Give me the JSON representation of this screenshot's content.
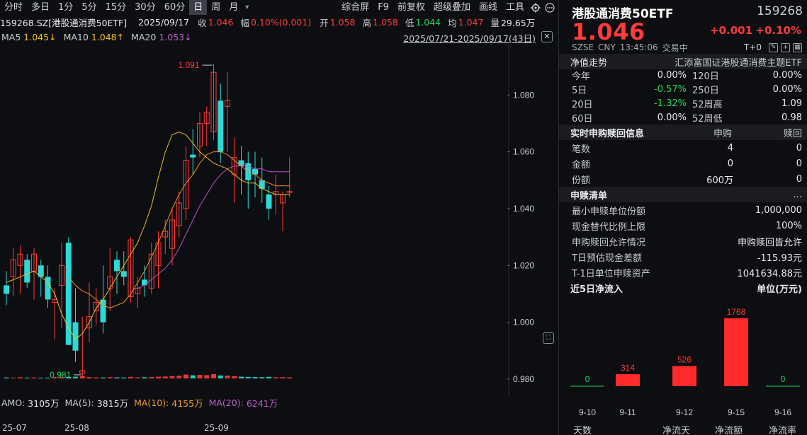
{
  "toolbar": {
    "periods": [
      "分时",
      "多日",
      "1分",
      "5分",
      "15分",
      "30分",
      "60分",
      "日",
      "周",
      "月"
    ],
    "active": "日",
    "right_items": [
      "综合屏",
      "F9",
      "前复权",
      "超级叠加",
      "画线",
      "工具"
    ]
  },
  "infoline": {
    "code": "159268.SZ[港股通消费50ETF]",
    "date": "2025/09/17",
    "close_label": "收",
    "close": "1.046",
    "amp_label": "幅",
    "amp": "0.10%(0.001)",
    "open_label": "开",
    "open": "1.058",
    "high_label": "高",
    "high": "1.058",
    "low_label": "低",
    "low": "1.044",
    "avg_label": "均",
    "avg": "1.047",
    "vol_label": "量",
    "vol": "29.65万"
  },
  "maline": {
    "ma5_label": "MA5",
    "ma5": "1.045↓",
    "ma10_label": "MA10",
    "ma10": "1.048↑",
    "ma20_label": "MA20",
    "ma20": "1.053↓"
  },
  "date_range": "2025/07/21-2025/09/17(43日)",
  "range_close": "✕",
  "amoline": {
    "amo_label": "AMO:",
    "amo": "3105万",
    "ma5_label": "MA(5):",
    "ma5": "3815万",
    "ma10_label": "MA(10):",
    "ma10": "4155万",
    "ma20_label": "MA(20):",
    "ma20": "6241万"
  },
  "xaxis": [
    "25-07",
    "25-08",
    "25-09"
  ],
  "chart_data": {
    "type": "candlestick",
    "y_ticks": [
      "1.080",
      "1.060",
      "1.040",
      "1.020",
      "1.000",
      "0.980"
    ],
    "ylim": [
      0.976,
      1.098
    ],
    "max_label": "1.091",
    "min_label": "0.981",
    "candles": [
      {
        "o": 1.013,
        "h": 1.018,
        "l": 1.006,
        "c": 1.01
      },
      {
        "o": 1.016,
        "h": 1.026,
        "l": 1.009,
        "c": 1.022
      },
      {
        "o": 1.02,
        "h": 1.027,
        "l": 1.01,
        "c": 1.024
      },
      {
        "o": 1.022,
        "h": 1.024,
        "l": 1.012,
        "c": 1.014
      },
      {
        "o": 1.018,
        "h": 1.026,
        "l": 1.008,
        "c": 1.024
      },
      {
        "o": 1.02,
        "h": 1.022,
        "l": 1.009,
        "c": 1.016
      },
      {
        "o": 1.016,
        "h": 1.02,
        "l": 1.005,
        "c": 1.008
      },
      {
        "o": 1.007,
        "h": 1.012,
        "l": 0.994,
        "c": 1.008
      },
      {
        "o": 1.013,
        "h": 1.028,
        "l": 0.998,
        "c": 1.02
      },
      {
        "o": 1.028,
        "h": 1.03,
        "l": 1.0,
        "c": 0.992
      },
      {
        "o": 1.0,
        "h": 1.012,
        "l": 0.986,
        "c": 0.99
      },
      {
        "o": 0.982,
        "h": 1.002,
        "l": 0.981,
        "c": 0.983
      },
      {
        "o": 0.998,
        "h": 1.014,
        "l": 0.993,
        "c": 1.002
      },
      {
        "o": 1.004,
        "h": 1.012,
        "l": 0.999,
        "c": 1.007
      },
      {
        "o": 1.008,
        "h": 1.02,
        "l": 0.996,
        "c": 1.0
      },
      {
        "o": 1.012,
        "h": 1.026,
        "l": 1.004,
        "c": 1.016
      },
      {
        "o": 1.022,
        "h": 1.025,
        "l": 1.01,
        "c": 1.018
      },
      {
        "o": 1.018,
        "h": 1.025,
        "l": 1.013,
        "c": 1.016
      },
      {
        "o": 1.009,
        "h": 1.03,
        "l": 1.007,
        "c": 1.029
      },
      {
        "o": 1.01,
        "h": 1.016,
        "l": 1.005,
        "c": 1.012
      },
      {
        "o": 1.015,
        "h": 1.02,
        "l": 1.009,
        "c": 1.013
      },
      {
        "o": 1.012,
        "h": 1.028,
        "l": 1.01,
        "c": 1.024
      },
      {
        "o": 1.02,
        "h": 1.032,
        "l": 1.012,
        "c": 1.028
      },
      {
        "o": 1.03,
        "h": 1.036,
        "l": 1.024,
        "c": 1.032
      },
      {
        "o": 1.026,
        "h": 1.04,
        "l": 1.02,
        "c": 1.036
      },
      {
        "o": 1.034,
        "h": 1.046,
        "l": 1.03,
        "c": 1.042
      },
      {
        "o": 1.04,
        "h": 1.062,
        "l": 1.036,
        "c": 1.057
      },
      {
        "o": 1.059,
        "h": 1.068,
        "l": 1.052,
        "c": 1.058
      },
      {
        "o": 1.062,
        "h": 1.074,
        "l": 1.058,
        "c": 1.07
      },
      {
        "o": 1.07,
        "h": 1.076,
        "l": 1.062,
        "c": 1.074
      },
      {
        "o": 1.067,
        "h": 1.091,
        "l": 1.064,
        "c": 1.088
      },
      {
        "o": 1.078,
        "h": 1.084,
        "l": 1.056,
        "c": 1.06
      },
      {
        "o": 1.076,
        "h": 1.088,
        "l": 1.06,
        "c": 1.078
      },
      {
        "o": 1.052,
        "h": 1.065,
        "l": 1.042,
        "c": 1.058
      },
      {
        "o": 1.057,
        "h": 1.062,
        "l": 1.045,
        "c": 1.055
      },
      {
        "o": 1.056,
        "h": 1.06,
        "l": 1.04,
        "c": 1.05
      },
      {
        "o": 1.054,
        "h": 1.06,
        "l": 1.044,
        "c": 1.052
      },
      {
        "o": 1.05,
        "h": 1.058,
        "l": 1.042,
        "c": 1.047
      },
      {
        "o": 1.045,
        "h": 1.048,
        "l": 1.036,
        "c": 1.04
      },
      {
        "o": 1.045,
        "h": 1.052,
        "l": 1.038,
        "c": 1.046
      },
      {
        "o": 1.042,
        "h": 1.046,
        "l": 1.032,
        "c": 1.045
      },
      {
        "o": 1.046,
        "h": 1.058,
        "l": 1.044,
        "c": 1.046
      }
    ],
    "ma5": [
      1.014,
      1.015,
      1.016,
      1.017,
      1.018,
      1.016,
      1.014,
      1.01,
      1.003,
      0.998,
      0.994,
      0.996,
      1.0,
      1.005,
      1.008,
      1.012,
      1.016,
      1.02,
      1.024,
      1.028,
      1.034,
      1.041,
      1.051,
      1.06,
      1.066,
      1.067,
      1.066,
      1.063,
      1.06,
      1.058,
      1.056,
      1.055,
      1.054,
      1.052,
      1.05,
      1.049,
      1.049,
      1.047,
      1.046,
      1.045,
      1.045,
      1.045
    ],
    "ma10": [
      null,
      null,
      null,
      null,
      null,
      null,
      null,
      null,
      null,
      1.016,
      1.013,
      1.011,
      1.01,
      1.008,
      1.006,
      1.005,
      1.006,
      1.007,
      1.01,
      1.014,
      1.018,
      1.023,
      1.028,
      1.034,
      1.04,
      1.045,
      1.049,
      1.052,
      1.056,
      1.059,
      1.06,
      1.06,
      1.059,
      1.057,
      1.055,
      1.053,
      1.052,
      1.05,
      1.049,
      1.048,
      1.048,
      1.048
    ],
    "ma20": [
      null,
      null,
      null,
      null,
      null,
      null,
      null,
      null,
      null,
      null,
      null,
      null,
      null,
      null,
      null,
      null,
      null,
      null,
      null,
      1.012,
      1.013,
      1.015,
      1.017,
      1.019,
      1.022,
      1.026,
      1.031,
      1.036,
      1.041,
      1.045,
      1.049,
      1.052,
      1.054,
      1.055,
      1.055,
      1.055,
      1.054,
      1.054,
      1.053,
      1.053,
      1.053,
      1.053
    ],
    "volume": [
      0.12,
      0.1,
      0.15,
      0.1,
      0.12,
      0.08,
      0.1,
      0.14,
      0.16,
      0.2,
      0.22,
      0.3,
      0.18,
      0.14,
      0.12,
      0.16,
      0.14,
      0.12,
      0.2,
      0.14,
      0.16,
      0.18,
      0.22,
      0.24,
      0.3,
      0.34,
      0.5,
      0.4,
      0.45,
      0.42,
      0.55,
      0.38,
      0.35,
      0.3,
      0.22,
      0.2,
      0.18,
      0.16,
      0.2,
      0.15,
      0.16,
      0.14
    ]
  },
  "right": {
    "title": "港股通消费50ETF",
    "code": "159268",
    "price": "1.046",
    "change": "+0.001",
    "pct": "+0.10%",
    "exchange": "SZSE",
    "currency": "CNY",
    "time": "13:45:06",
    "status": "交易中",
    "t0": "T+0",
    "nav_head": "净值走势",
    "nav_name": "汇添富国证港股通消费主题ETF",
    "perf": [
      {
        "k1": "今年",
        "v1": "0.00%",
        "v1c": "white",
        "k2": "120日",
        "v2": "0.00%"
      },
      {
        "k1": "5日",
        "v1": "-0.57%",
        "v1c": "green",
        "k2": "250日",
        "v2": "0.00%"
      },
      {
        "k1": "20日",
        "v1": "-1.32%",
        "v1c": "green",
        "k2": "52周高",
        "v2": "1.09"
      },
      {
        "k1": "60日",
        "v1": "0.00%",
        "v1c": "white",
        "k2": "52周低",
        "v2": "0.98"
      }
    ],
    "sub_head": {
      "title": "实时申购赎回信息",
      "col1": "申购",
      "col2": "赎回"
    },
    "sub_rows": [
      {
        "k": "笔数",
        "v1": "4",
        "v2": "0"
      },
      {
        "k": "金额",
        "v1": "0",
        "v2": "0"
      },
      {
        "k": "份额",
        "v1": "600万",
        "v2": "0"
      }
    ],
    "list_head": {
      "title": "申赎清单",
      "more": "..."
    },
    "list_rows": [
      {
        "k": "最小申赎单位份额",
        "v": "1,000,000"
      },
      {
        "k": "现金替代比例上限",
        "v": "100%"
      },
      {
        "k": "申购赎回允许情况",
        "v": "申购赎回皆允许"
      },
      {
        "k": "T日预估现金差额",
        "v": "-115.93元"
      },
      {
        "k": "T-1日单位申赎资产",
        "v": "1041634.88元"
      }
    ],
    "flow_head": {
      "title": "近5日净流入",
      "unit": "单位(万元)"
    },
    "flow_chart": {
      "type": "bar",
      "categories": [
        "9-10",
        "9-11",
        "9-12",
        "9-15",
        "9-16"
      ],
      "values": [
        0,
        314,
        526,
        1768,
        0
      ],
      "labels": [
        "0",
        "314",
        "526",
        "1768",
        "0"
      ]
    },
    "bottom_tabs": [
      "天数",
      "净流天",
      "净流额",
      "净流率"
    ]
  },
  "colors": {
    "up": "#ff3b3b",
    "down": "#2ed8d8",
    "ma5": "#f0c020",
    "ma10": "#f09020",
    "ma20": "#c050c8",
    "bg": "#0d0e11"
  }
}
